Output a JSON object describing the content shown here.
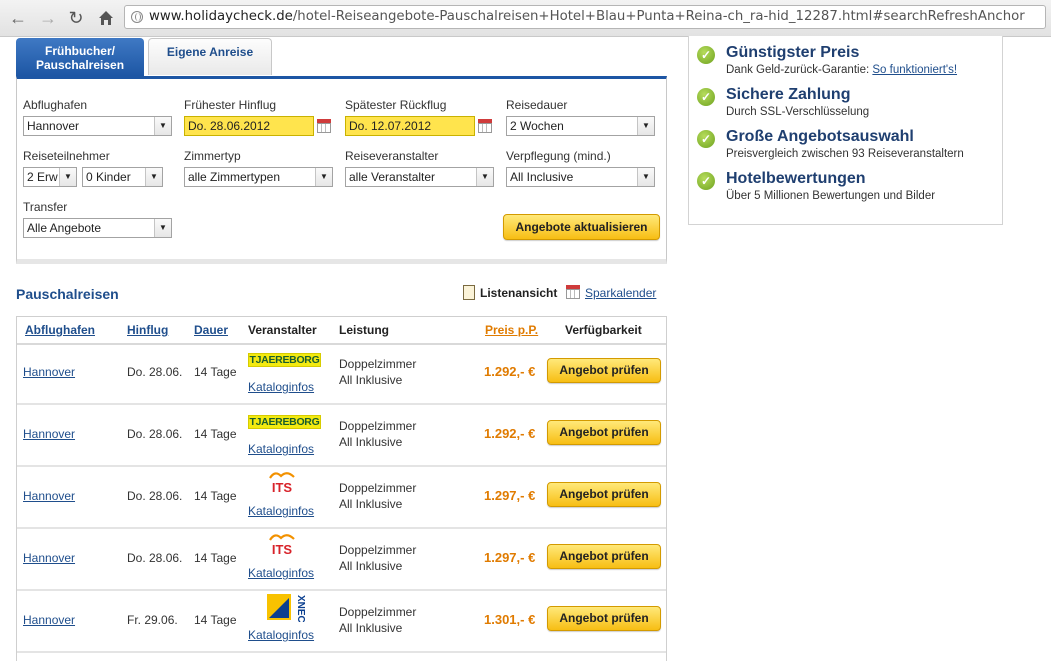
{
  "browser": {
    "url_host": "www.holidaycheck.de",
    "url_path": "/hotel-Reiseangebote-Pauschalreisen+Hotel+Blau+Punta+Reina-ch_ra-hid_12287.html#searchRefreshAnchor"
  },
  "search": {
    "tabs": [
      {
        "label_line1": "Frühbucher/",
        "label_line2": "Pauschalreisen",
        "active": true
      },
      {
        "label": "Eigene Anreise",
        "active": false
      }
    ],
    "fields": {
      "departure_airport": {
        "label": "Abflughafen",
        "value": "Hannover"
      },
      "earliest_outbound": {
        "label": "Frühester Hinflug",
        "value": "Do. 28.06.2012"
      },
      "latest_return": {
        "label": "Spätester Rückflug",
        "value": "Do. 12.07.2012"
      },
      "duration": {
        "label": "Reisedauer",
        "value": "2 Wochen"
      },
      "travellers": {
        "label": "Reiseteilnehmer",
        "adults": "2 Erw",
        "children": "0 Kinder"
      },
      "room_type": {
        "label": "Zimmertyp",
        "value": "alle Zimmertypen"
      },
      "tour_operator": {
        "label": "Reiseveranstalter",
        "value": "alle Veranstalter"
      },
      "board": {
        "label": "Verpflegung (mind.)",
        "value": "All Inclusive"
      },
      "transfer": {
        "label": "Transfer",
        "value": "Alle Angebote"
      }
    },
    "update_label": "Angebote aktualisieren"
  },
  "results": {
    "title": "Pauschalreisen",
    "list_view_label": "Listenansicht",
    "savings_calendar_label": "Sparkalender",
    "columns": {
      "airport": "Abflughafen",
      "outbound": "Hinflug",
      "duration": "Dauer",
      "operator": "Veranstalter",
      "service": "Leistung",
      "price": "Preis p.P.",
      "availability": "Verfügbarkeit"
    },
    "rows": [
      {
        "airport": "Hannover",
        "outbound": "Do. 28.06.",
        "duration": "14 Tage",
        "operator_logo": "TJAEREBORG",
        "catalog": "Kataloginfos",
        "room": "Doppelzimmer",
        "board": "All Inklusive",
        "price": "1.292,- €",
        "check_label": "Angebot prüfen"
      },
      {
        "airport": "Hannover",
        "outbound": "Do. 28.06.",
        "duration": "14 Tage",
        "operator_logo": "TJAEREBORG",
        "catalog": "Kataloginfos",
        "room": "Doppelzimmer",
        "board": "All Inklusive",
        "price": "1.292,- €",
        "check_label": "Angebot prüfen"
      },
      {
        "airport": "Hannover",
        "outbound": "Do. 28.06.",
        "duration": "14 Tage",
        "operator_logo": "ITS",
        "catalog": "Kataloginfos",
        "room": "Doppelzimmer",
        "board": "All Inklusive",
        "price": "1.297,- €",
        "check_label": "Angebot prüfen"
      },
      {
        "airport": "Hannover",
        "outbound": "Do. 28.06.",
        "duration": "14 Tage",
        "operator_logo": "ITS",
        "catalog": "Kataloginfos",
        "room": "Doppelzimmer",
        "board": "All Inklusive",
        "price": "1.297,- €",
        "check_label": "Angebot prüfen"
      },
      {
        "airport": "Hannover",
        "outbound": "Fr. 29.06.",
        "duration": "14 Tage",
        "operator_logo": "XNEC",
        "catalog": "Kataloginfos",
        "room": "Doppelzimmer",
        "board": "All Inklusive",
        "price": "1.301,- €",
        "check_label": "Angebot prüfen"
      }
    ]
  },
  "usps": [
    {
      "title": "Günstigster Preis",
      "sub": "Dank Geld-zurück-Garantie:",
      "link": "So funktioniert's!"
    },
    {
      "title": "Sichere Zahlung",
      "sub": "Durch SSL-Verschlüsselung"
    },
    {
      "title": "Große Angebotsauswahl",
      "sub": "Preisvergleich zwischen 93 Reiseveranstaltern"
    },
    {
      "title": "Hotelbewertungen",
      "sub": "Über 5 Millionen Bewertungen und Bilder"
    }
  ],
  "colors": {
    "brand_blue": "#1d56a4",
    "price_orange": "#e07b00",
    "button_yellow": "#f7be14",
    "date_yellow": "#ffe44d"
  }
}
